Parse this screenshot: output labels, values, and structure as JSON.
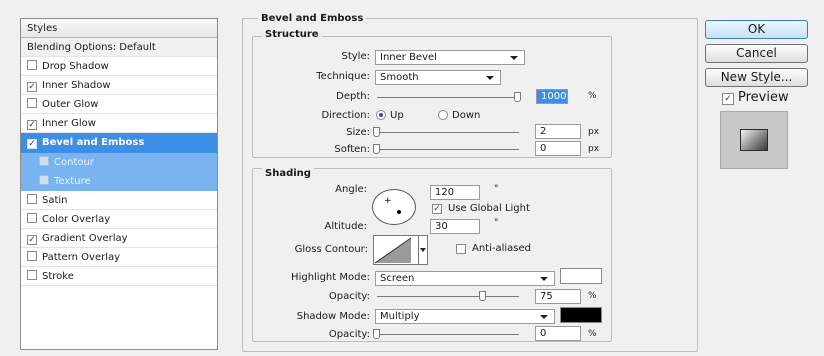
{
  "styles_panel": {
    "header": "Styles",
    "items": [
      {
        "label": "Blending Options: Default",
        "checkbox": "none",
        "state": "normal"
      },
      {
        "label": "Drop Shadow",
        "checkbox": "off",
        "state": "normal"
      },
      {
        "label": "Inner Shadow",
        "checkbox": "on",
        "state": "normal"
      },
      {
        "label": "Outer Glow",
        "checkbox": "off",
        "state": "normal"
      },
      {
        "label": "Inner Glow",
        "checkbox": "on",
        "state": "normal"
      },
      {
        "label": "Bevel and Emboss",
        "checkbox": "on",
        "state": "selected"
      },
      {
        "label": "Contour",
        "checkbox": "small",
        "state": "sub-selected"
      },
      {
        "label": "Texture",
        "checkbox": "small",
        "state": "sub-selected"
      },
      {
        "label": "Satin",
        "checkbox": "off",
        "state": "normal"
      },
      {
        "label": "Color Overlay",
        "checkbox": "off",
        "state": "normal"
      },
      {
        "label": "Gradient Overlay",
        "checkbox": "on",
        "state": "normal"
      },
      {
        "label": "Pattern Overlay",
        "checkbox": "off",
        "state": "normal"
      },
      {
        "label": "Stroke",
        "checkbox": "off",
        "state": "normal"
      }
    ]
  },
  "bevel": {
    "title": "Bevel and Emboss",
    "structure": {
      "title": "Structure",
      "style_label": "Style:",
      "style_value": "Inner Bevel",
      "technique_label": "Technique:",
      "technique_value": "Smooth",
      "depth_label": "Depth:",
      "depth_value": "1000",
      "depth_unit": "%",
      "depth_fraction": 1.0,
      "direction_label": "Direction:",
      "direction_up": "Up",
      "direction_down": "Down",
      "direction_selected": "Up",
      "size_label": "Size:",
      "size_value": "2",
      "size_unit": "px",
      "size_fraction": 0.0,
      "soften_label": "Soften:",
      "soften_value": "0",
      "soften_unit": "px",
      "soften_fraction": 0.0
    },
    "shading": {
      "title": "Shading",
      "angle_label": "Angle:",
      "angle_value": "120",
      "angle_unit": "°",
      "use_global_light": "Use Global Light",
      "use_global_light_checked": true,
      "altitude_label": "Altitude:",
      "altitude_value": "30",
      "altitude_unit": "°",
      "gloss_contour_label": "Gloss Contour:",
      "anti_aliased": "Anti-aliased",
      "anti_aliased_checked": false,
      "highlight_mode_label": "Highlight Mode:",
      "highlight_mode_value": "Screen",
      "highlight_color": "#ffffff",
      "highlight_opacity_label": "Opacity:",
      "highlight_opacity_value": "75",
      "highlight_opacity_unit": "%",
      "highlight_opacity_fraction": 0.75,
      "shadow_mode_label": "Shadow Mode:",
      "shadow_mode_value": "Multiply",
      "shadow_color": "#000000",
      "shadow_opacity_label": "Opacity:",
      "shadow_opacity_value": "0",
      "shadow_opacity_unit": "%",
      "shadow_opacity_fraction": 0.0
    }
  },
  "buttons": {
    "ok": "OK",
    "cancel": "Cancel",
    "new_style": "New Style...",
    "preview": "Preview",
    "preview_checked": true
  },
  "colors": {
    "selection": "#3d8ee6",
    "sub_selection": "#7ab4f0",
    "panel_bg": "#f0f0f0"
  }
}
